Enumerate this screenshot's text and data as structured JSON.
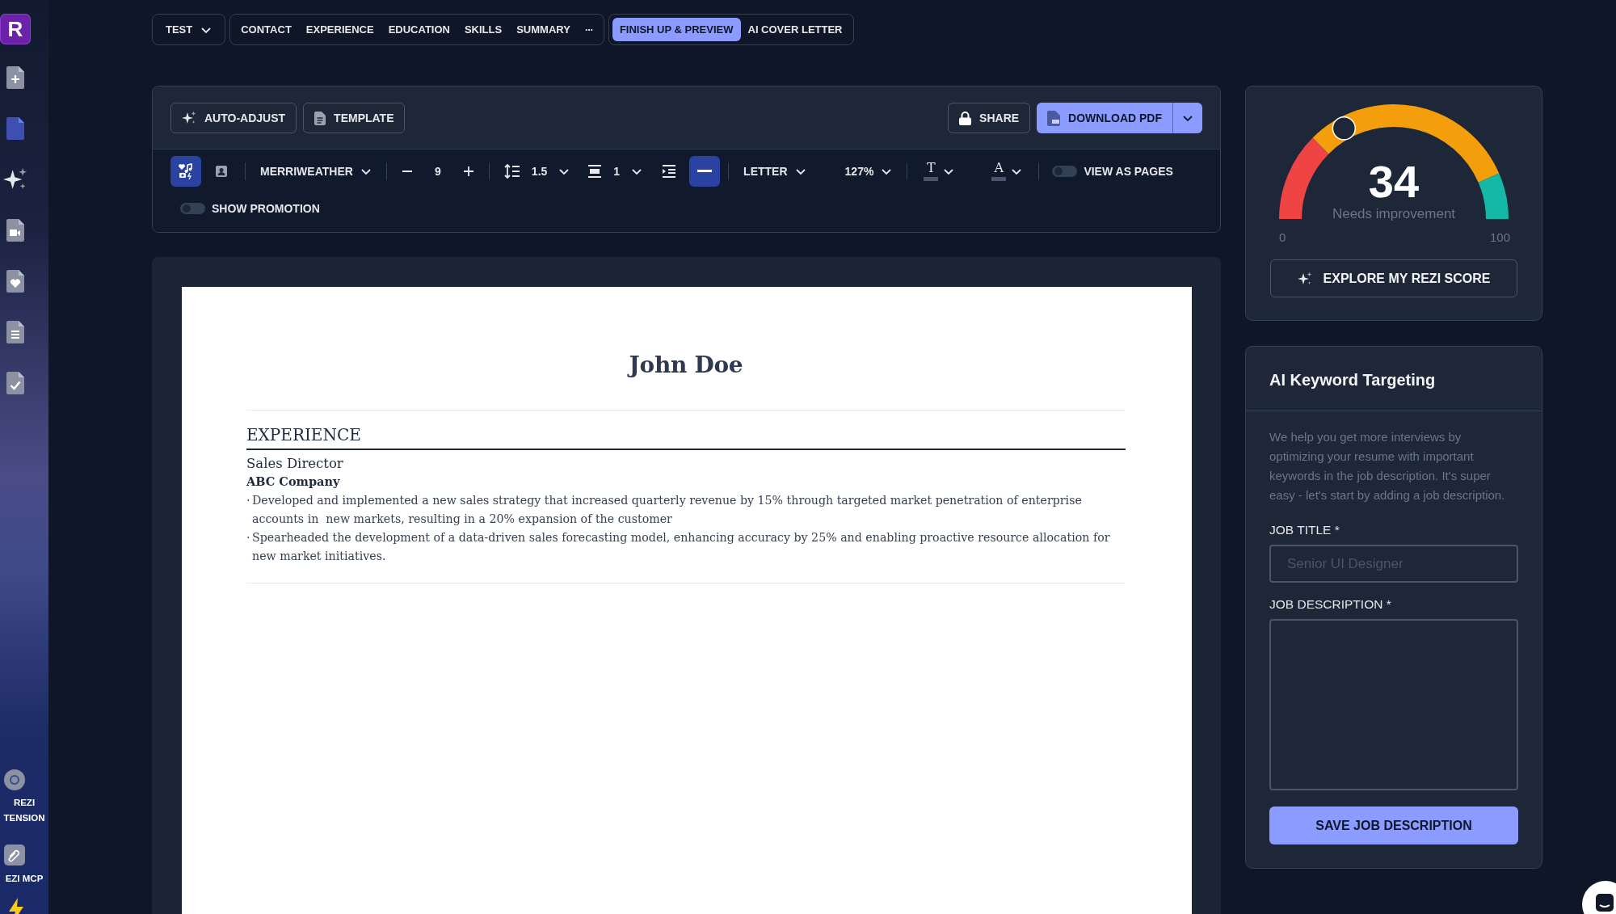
{
  "sidebar": {
    "items": [
      {
        "kind": "logo",
        "label": "R"
      },
      {
        "kind": "add",
        "selected": false
      },
      {
        "kind": "resume",
        "selected": true
      },
      {
        "kind": "ai",
        "selected": false
      },
      {
        "kind": "video",
        "selected": false
      },
      {
        "kind": "heart",
        "selected": false
      },
      {
        "kind": "lines",
        "selected": false
      },
      {
        "kind": "check",
        "selected": false
      }
    ],
    "bottom": [
      {
        "kind": "extension",
        "label": "REZI TENSION"
      },
      {
        "kind": "mcp",
        "label": "EZI MCP"
      },
      {
        "kind": "bolt"
      }
    ]
  },
  "nav": {
    "resume_menu": {
      "label": "TEST"
    },
    "sections": [
      {
        "label": "CONTACT",
        "selected": false
      },
      {
        "label": "EXPERIENCE",
        "selected": false
      },
      {
        "label": "EDUCATION",
        "selected": false
      },
      {
        "label": "SKILLS",
        "selected": false
      },
      {
        "label": "SUMMARY",
        "selected": false
      }
    ],
    "more": "···",
    "finish": [
      {
        "label": "FINISH UP & PREVIEW",
        "selected": true
      },
      {
        "label": "AI COVER LETTER",
        "selected": false
      }
    ]
  },
  "toolbar": {
    "left": [
      {
        "kind": "auto",
        "label": "AUTO-ADJUST"
      },
      {
        "kind": "template",
        "label": "TEMPLATE"
      }
    ],
    "share": {
      "label": "SHARE"
    },
    "download": {
      "label": "DOWNLOAD PDF"
    },
    "format_rows": [
      [
        [
          {
            "kind": "design",
            "selected": true
          },
          {
            "kind": "profile",
            "selected": false
          }
        ],
        [
          {
            "kind": "dropdown",
            "label": "MERRIWEATHER"
          }
        ],
        [
          {
            "kind": "stepper",
            "value": "9"
          }
        ],
        [
          {
            "kind": "spacing",
            "value": "1.5"
          },
          {
            "kind": "margin",
            "value": "1"
          },
          {
            "kind": "indent",
            "selected": false
          },
          {
            "kind": "rule",
            "selected": true
          }
        ],
        [
          {
            "kind": "dropdown",
            "label": "LETTER"
          },
          {
            "kind": "dropdown",
            "label": "127%"
          }
        ],
        [
          {
            "kind": "color",
            "label": "T"
          },
          {
            "kind": "color",
            "label": "A"
          }
        ],
        [
          {
            "kind": "toggle",
            "label": "VIEW AS PAGES",
            "on": false
          }
        ]
      ],
      [
        [
          {
            "kind": "toggle",
            "label": "SHOW PROMOTION",
            "on": false
          }
        ]
      ]
    ]
  },
  "resume": {
    "name": "John Doe",
    "sections": [
      {
        "title": "EXPERIENCE",
        "entries": [
          {
            "role": "Sales Director",
            "company": "ABC Company",
            "bullets": [
              {
                "marker": "·",
                "text": "Developed and implemented a new sales strategy that increased quarterly revenue by 15% through targeted market penetration of enterprise accounts in  new markets, resulting in a 20% expansion of the customer"
              },
              {
                "marker": "·",
                "text": "Spearheaded the development of a data-driven sales forecasting model, enhancing accuracy by 25% and enabling proactive resource allocation for new market initiatives."
              }
            ]
          }
        ]
      }
    ]
  },
  "score": {
    "value": "34",
    "level": 0.34,
    "caption": "Needs improvement",
    "min_label": "0",
    "max_label": "100",
    "button": "EXPLORE MY REZI SCORE"
  },
  "keywords": {
    "title": "AI Keyword Targeting",
    "description": "We help you get more interviews by optimizing your resume with important keywords in the job description. It's super easy - let's start by adding a job description.",
    "job_title": {
      "label": "JOB TITLE *",
      "placeholder": "Senior UI Designer"
    },
    "job_description": {
      "label": "JOB DESCRIPTION *"
    },
    "button": "SAVE JOB DESCRIPTION"
  }
}
